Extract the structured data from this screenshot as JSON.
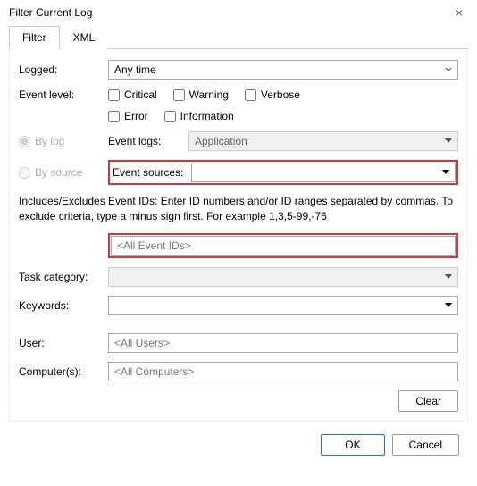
{
  "dialog": {
    "title": "Filter Current Log",
    "close_symbol": "×"
  },
  "tabs": {
    "filter": "Filter",
    "xml": "XML"
  },
  "form": {
    "logged_label": "Logged:",
    "logged_value": "Any time",
    "event_level_label": "Event level:",
    "levels": {
      "critical": "Critical",
      "warning": "Warning",
      "verbose": "Verbose",
      "error": "Error",
      "information": "Information"
    },
    "by_log_label": "By log",
    "event_logs_label": "Event logs:",
    "event_logs_value": "Application",
    "by_source_label": "By source",
    "event_sources_label": "Event sources:",
    "event_sources_value": "",
    "help_text": "Includes/Excludes Event IDs: Enter ID numbers and/or ID ranges separated by commas. To exclude criteria, type a minus sign first. For example 1,3,5-99,-76",
    "event_ids_value": "<All Event IDs>",
    "task_category_label": "Task category:",
    "task_category_value": "",
    "keywords_label": "Keywords:",
    "keywords_value": "",
    "user_label": "User:",
    "user_value": "<All Users>",
    "computers_label": "Computer(s):",
    "computers_value": "<All Computers>",
    "clear_button": "Clear"
  },
  "buttons": {
    "ok": "OK",
    "cancel": "Cancel"
  }
}
